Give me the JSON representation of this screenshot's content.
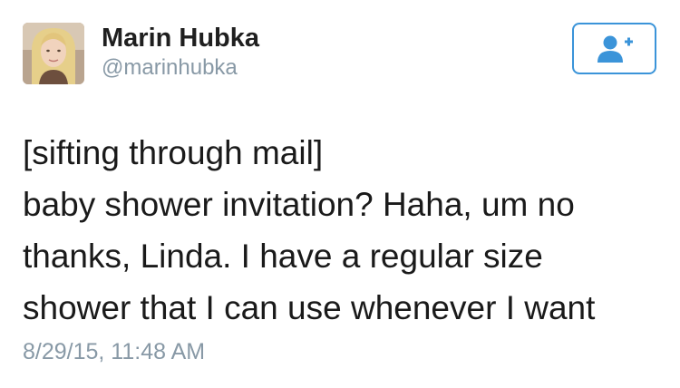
{
  "user": {
    "display_name": "Marin Hubka",
    "handle": "@marinhubka",
    "avatar_icon": "profile-photo"
  },
  "follow_button": {
    "icon": "add-user-icon",
    "color": "#3b94d9"
  },
  "tweet": {
    "lines": [
      "[sifting through mail]",
      "baby shower invitation? Haha, um no",
      "thanks, Linda. I have a regular size",
      "shower that I can use whenever I want"
    ],
    "timestamp": "8/29/15, 11:48 AM"
  },
  "colors": {
    "text": "#1a1a1a",
    "secondary": "#8899a6",
    "accent": "#3b94d9"
  }
}
